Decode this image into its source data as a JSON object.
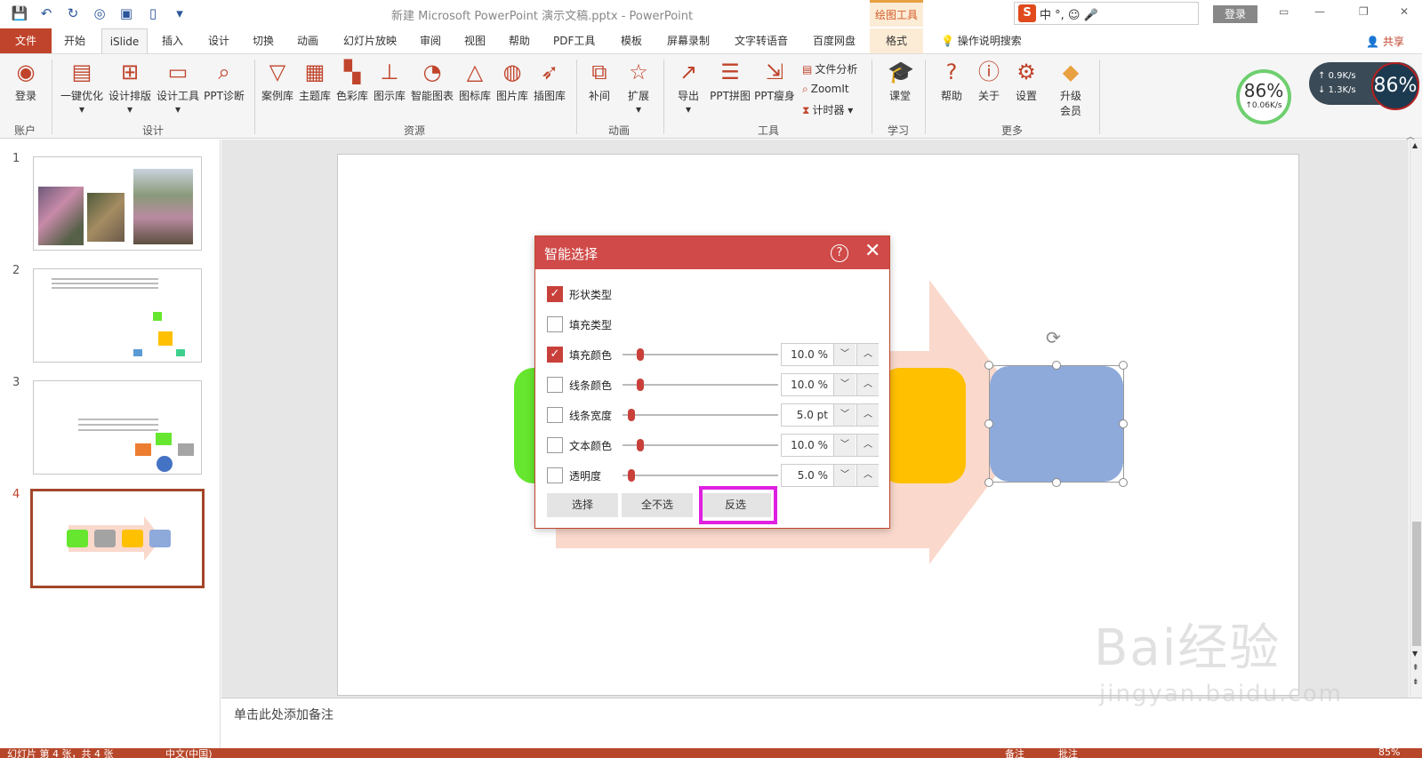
{
  "titlebar": {
    "doc_title": "新建 Microsoft PowerPoint 演示文稿.pptx  -  PowerPoint",
    "drawing_tools": "绘图工具",
    "ime_text": "中 °, ☺ 🎤",
    "login": "登录"
  },
  "tabs": {
    "file": "文件",
    "items": [
      "开始",
      "iSlide",
      "插入",
      "设计",
      "切换",
      "动画",
      "幻灯片放映",
      "审阅",
      "视图",
      "帮助",
      "PDF工具",
      "模板",
      "屏幕录制",
      "文字转语音",
      "百度网盘",
      "格式"
    ],
    "search": "操作说明搜索",
    "share": "共享"
  },
  "ribbon": {
    "login": "登录",
    "one_key": "一键优化",
    "design_layout": "设计排版",
    "design_tools": "设计工具",
    "ppt_diag": "PPT诊断",
    "case_lib": "案例库",
    "theme_lib": "主题库",
    "color_lib": "色彩库",
    "diagram_lib": "图示库",
    "smart_chart": "智能图表",
    "icon_lib": "图标库",
    "image_lib": "图片库",
    "illustration_lib": "插图库",
    "tween": "补间",
    "extend": "扩展",
    "export": "导出",
    "ppt_collage": "PPT拼图",
    "ppt_slim": "PPT瘦身",
    "file_analysis": "文件分析",
    "zoomit": "ZoomIt",
    "timer": "计时器",
    "classroom": "课堂",
    "help": "帮助",
    "about": "关于",
    "settings": "设置",
    "upgrade_1": "升级",
    "upgrade_2": "会员",
    "groups": [
      "账户",
      "设计",
      "资源",
      "动画",
      "工具",
      "学习",
      "更多"
    ]
  },
  "perf": {
    "percent": "86%",
    "speed": "↑0.06K/s"
  },
  "net": {
    "up": "0.9K/s",
    "down": "1.3K/s",
    "percent": "86%"
  },
  "slides": [
    "1",
    "2",
    "3",
    "4"
  ],
  "notes": {
    "placeholder": "单击此处添加备注"
  },
  "status": {
    "slide_info": "幻灯片 第 4 张，共 4 张",
    "lang": "中文(中国)",
    "notes": "备注",
    "comments": "批注",
    "zoom": "85%"
  },
  "dialog": {
    "title": "智能选择",
    "help": "?",
    "close": "✕",
    "rows": [
      {
        "label": "形状类型",
        "checked": true
      },
      {
        "label": "填充类型",
        "checked": false
      },
      {
        "label": "填充颜色",
        "checked": true,
        "value": "10.0 %"
      },
      {
        "label": "线条颜色",
        "checked": false,
        "value": "10.0 %"
      },
      {
        "label": "线条宽度",
        "checked": false,
        "value": "5.0 pt"
      },
      {
        "label": "文本颜色",
        "checked": false,
        "value": "10.0 %"
      },
      {
        "label": "透明度",
        "checked": false,
        "value": "5.0 %"
      }
    ],
    "btn_select": "选择",
    "btn_none": "全不选",
    "btn_invert": "反选"
  },
  "colors": {
    "accent": "#c0442b",
    "green": "#66e62e",
    "gray": "#a3a3a3",
    "yellow": "#ffc000",
    "blue": "#8eaadb",
    "arrow": "#fad9cc"
  },
  "watermark": {
    "main": "Bai经验",
    "sub": "jingyan.baidu.com"
  }
}
